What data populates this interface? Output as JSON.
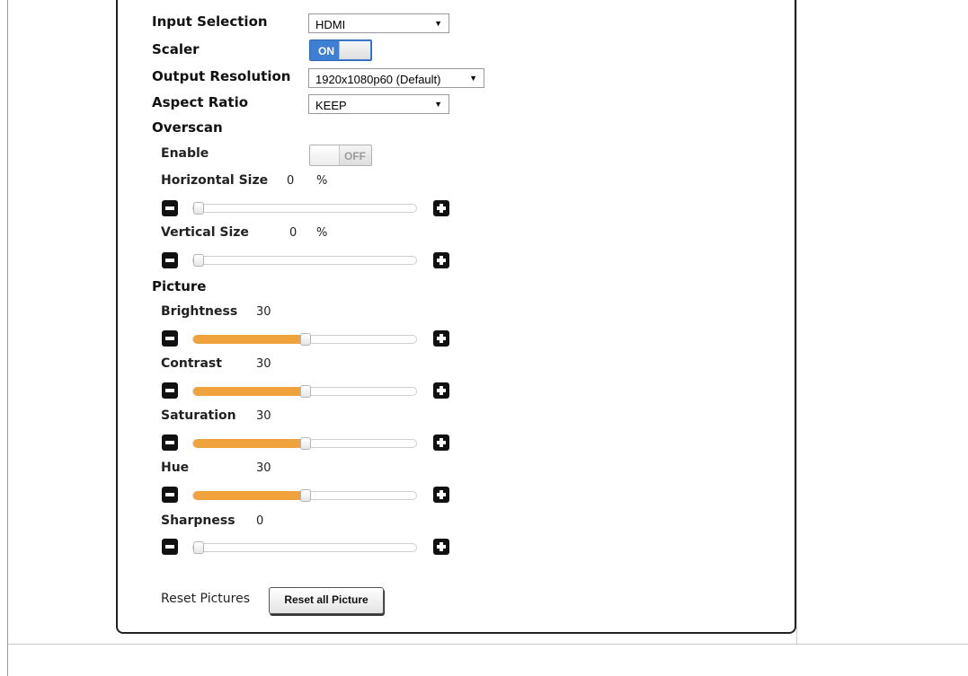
{
  "input_selection": {
    "label": "Input Selection",
    "value": "HDMI"
  },
  "scaler": {
    "label": "Scaler",
    "state": "ON"
  },
  "output_resolution": {
    "label": "Output Resolution",
    "value": "1920x1080p60 (Default)"
  },
  "aspect_ratio": {
    "label": "Aspect Ratio",
    "value": "KEEP"
  },
  "overscan": {
    "label": "Overscan",
    "enable_label": "Enable",
    "enable_state": "OFF",
    "horizontal": {
      "label": "Horizontal Size",
      "value": "0",
      "unit": "%",
      "fraction": 0
    },
    "vertical": {
      "label": "Vertical Size",
      "value": "0",
      "unit": "%",
      "fraction": 0
    }
  },
  "picture": {
    "label": "Picture",
    "brightness": {
      "label": "Brightness",
      "value": "30",
      "fraction": 0.5
    },
    "contrast": {
      "label": "Contrast",
      "value": "30",
      "fraction": 0.5
    },
    "saturation": {
      "label": "Saturation",
      "value": "30",
      "fraction": 0.5
    },
    "hue": {
      "label": "Hue",
      "value": "30",
      "fraction": 0.5
    },
    "sharpness": {
      "label": "Sharpness",
      "value": "0",
      "fraction": 0
    }
  },
  "reset": {
    "label": "Reset Pictures",
    "button": "Reset all Picture"
  },
  "colors": {
    "accent_fill": "#f0a33c",
    "toggle_on": "#3e7fd3"
  },
  "icons": {
    "decrease": "minus-icon",
    "increase": "plus-icon",
    "dropdown": "caret-down-icon"
  }
}
